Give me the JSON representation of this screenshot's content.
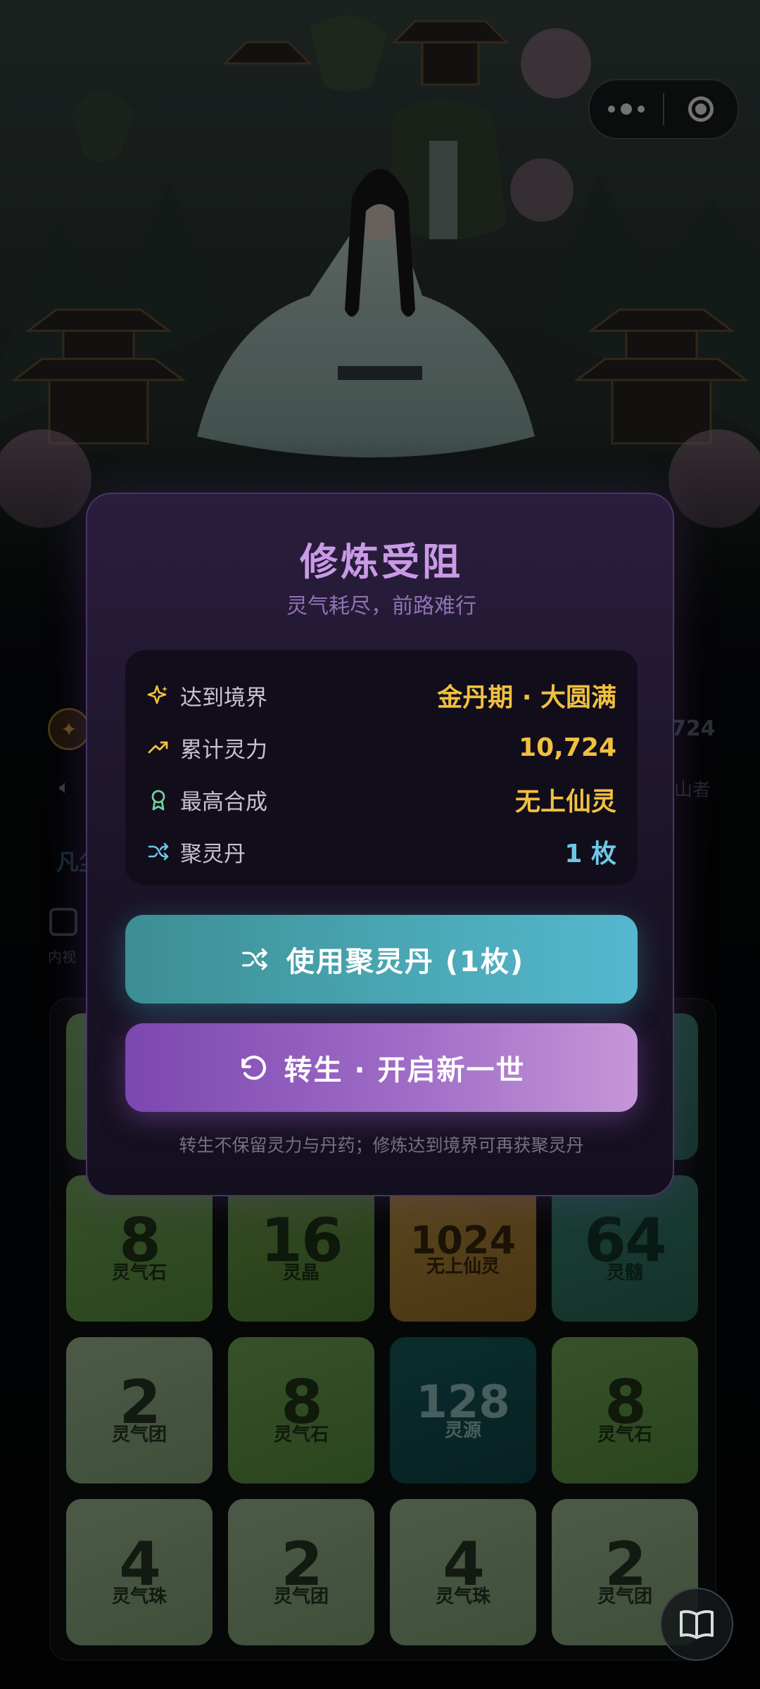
{
  "capsule": {
    "more_icon": "more-dots-icon",
    "close_icon": "target-close-icon"
  },
  "background": {
    "right_number": "724",
    "right_sub": "山者",
    "left_label": "凡尘",
    "bag_label": "内视"
  },
  "board": {
    "tiles": [
      {
        "value": "8",
        "name": "灵气石",
        "style": "green"
      },
      {
        "value": "16",
        "name": "灵晶",
        "style": "green2"
      },
      {
        "value": "1024",
        "name": "无上仙灵",
        "style": "amber"
      },
      {
        "value": "64",
        "name": "灵髓",
        "style": "sea"
      },
      {
        "value": "2",
        "name": "灵气团",
        "style": "pale"
      },
      {
        "value": "8",
        "name": "灵气石",
        "style": "green"
      },
      {
        "value": "128",
        "name": "灵源",
        "style": "teal"
      },
      {
        "value": "8",
        "name": "灵气石",
        "style": "green"
      },
      {
        "value": "4",
        "name": "灵气珠",
        "style": "pale"
      },
      {
        "value": "2",
        "name": "灵气团",
        "style": "pale"
      },
      {
        "value": "4",
        "name": "灵气珠",
        "style": "pale"
      },
      {
        "value": "2",
        "name": "灵气团",
        "style": "pale"
      }
    ]
  },
  "modal": {
    "title": "修炼受阻",
    "subtitle": "灵气耗尽，前路难行",
    "stats": [
      {
        "icon": "sparkle-icon",
        "label": "达到境界",
        "value": "金丹期 · 大圆满",
        "color": "#f0c040"
      },
      {
        "icon": "trending-up-icon",
        "label": "累计灵力",
        "value": "10,724",
        "color": "#f0c040"
      },
      {
        "icon": "award-icon",
        "label": "最高合成",
        "value": "无上仙灵",
        "color": "#f0c040"
      },
      {
        "icon": "shuffle-icon",
        "label": "聚灵丹",
        "value": "1 枚",
        "color": "#6cc9e6"
      }
    ],
    "use_pill_button": "使用聚灵丹 (1枚)",
    "rebirth_button": "转生 · 开启新一世",
    "footnote": "转生不保留灵力与丹药；修炼达到境界可再获聚灵丹"
  },
  "colors": {
    "accent_gold": "#f0c040",
    "accent_teal": "#4aa7b4",
    "accent_purple": "#9f6cc6",
    "title_purple": "#c99ae6"
  }
}
